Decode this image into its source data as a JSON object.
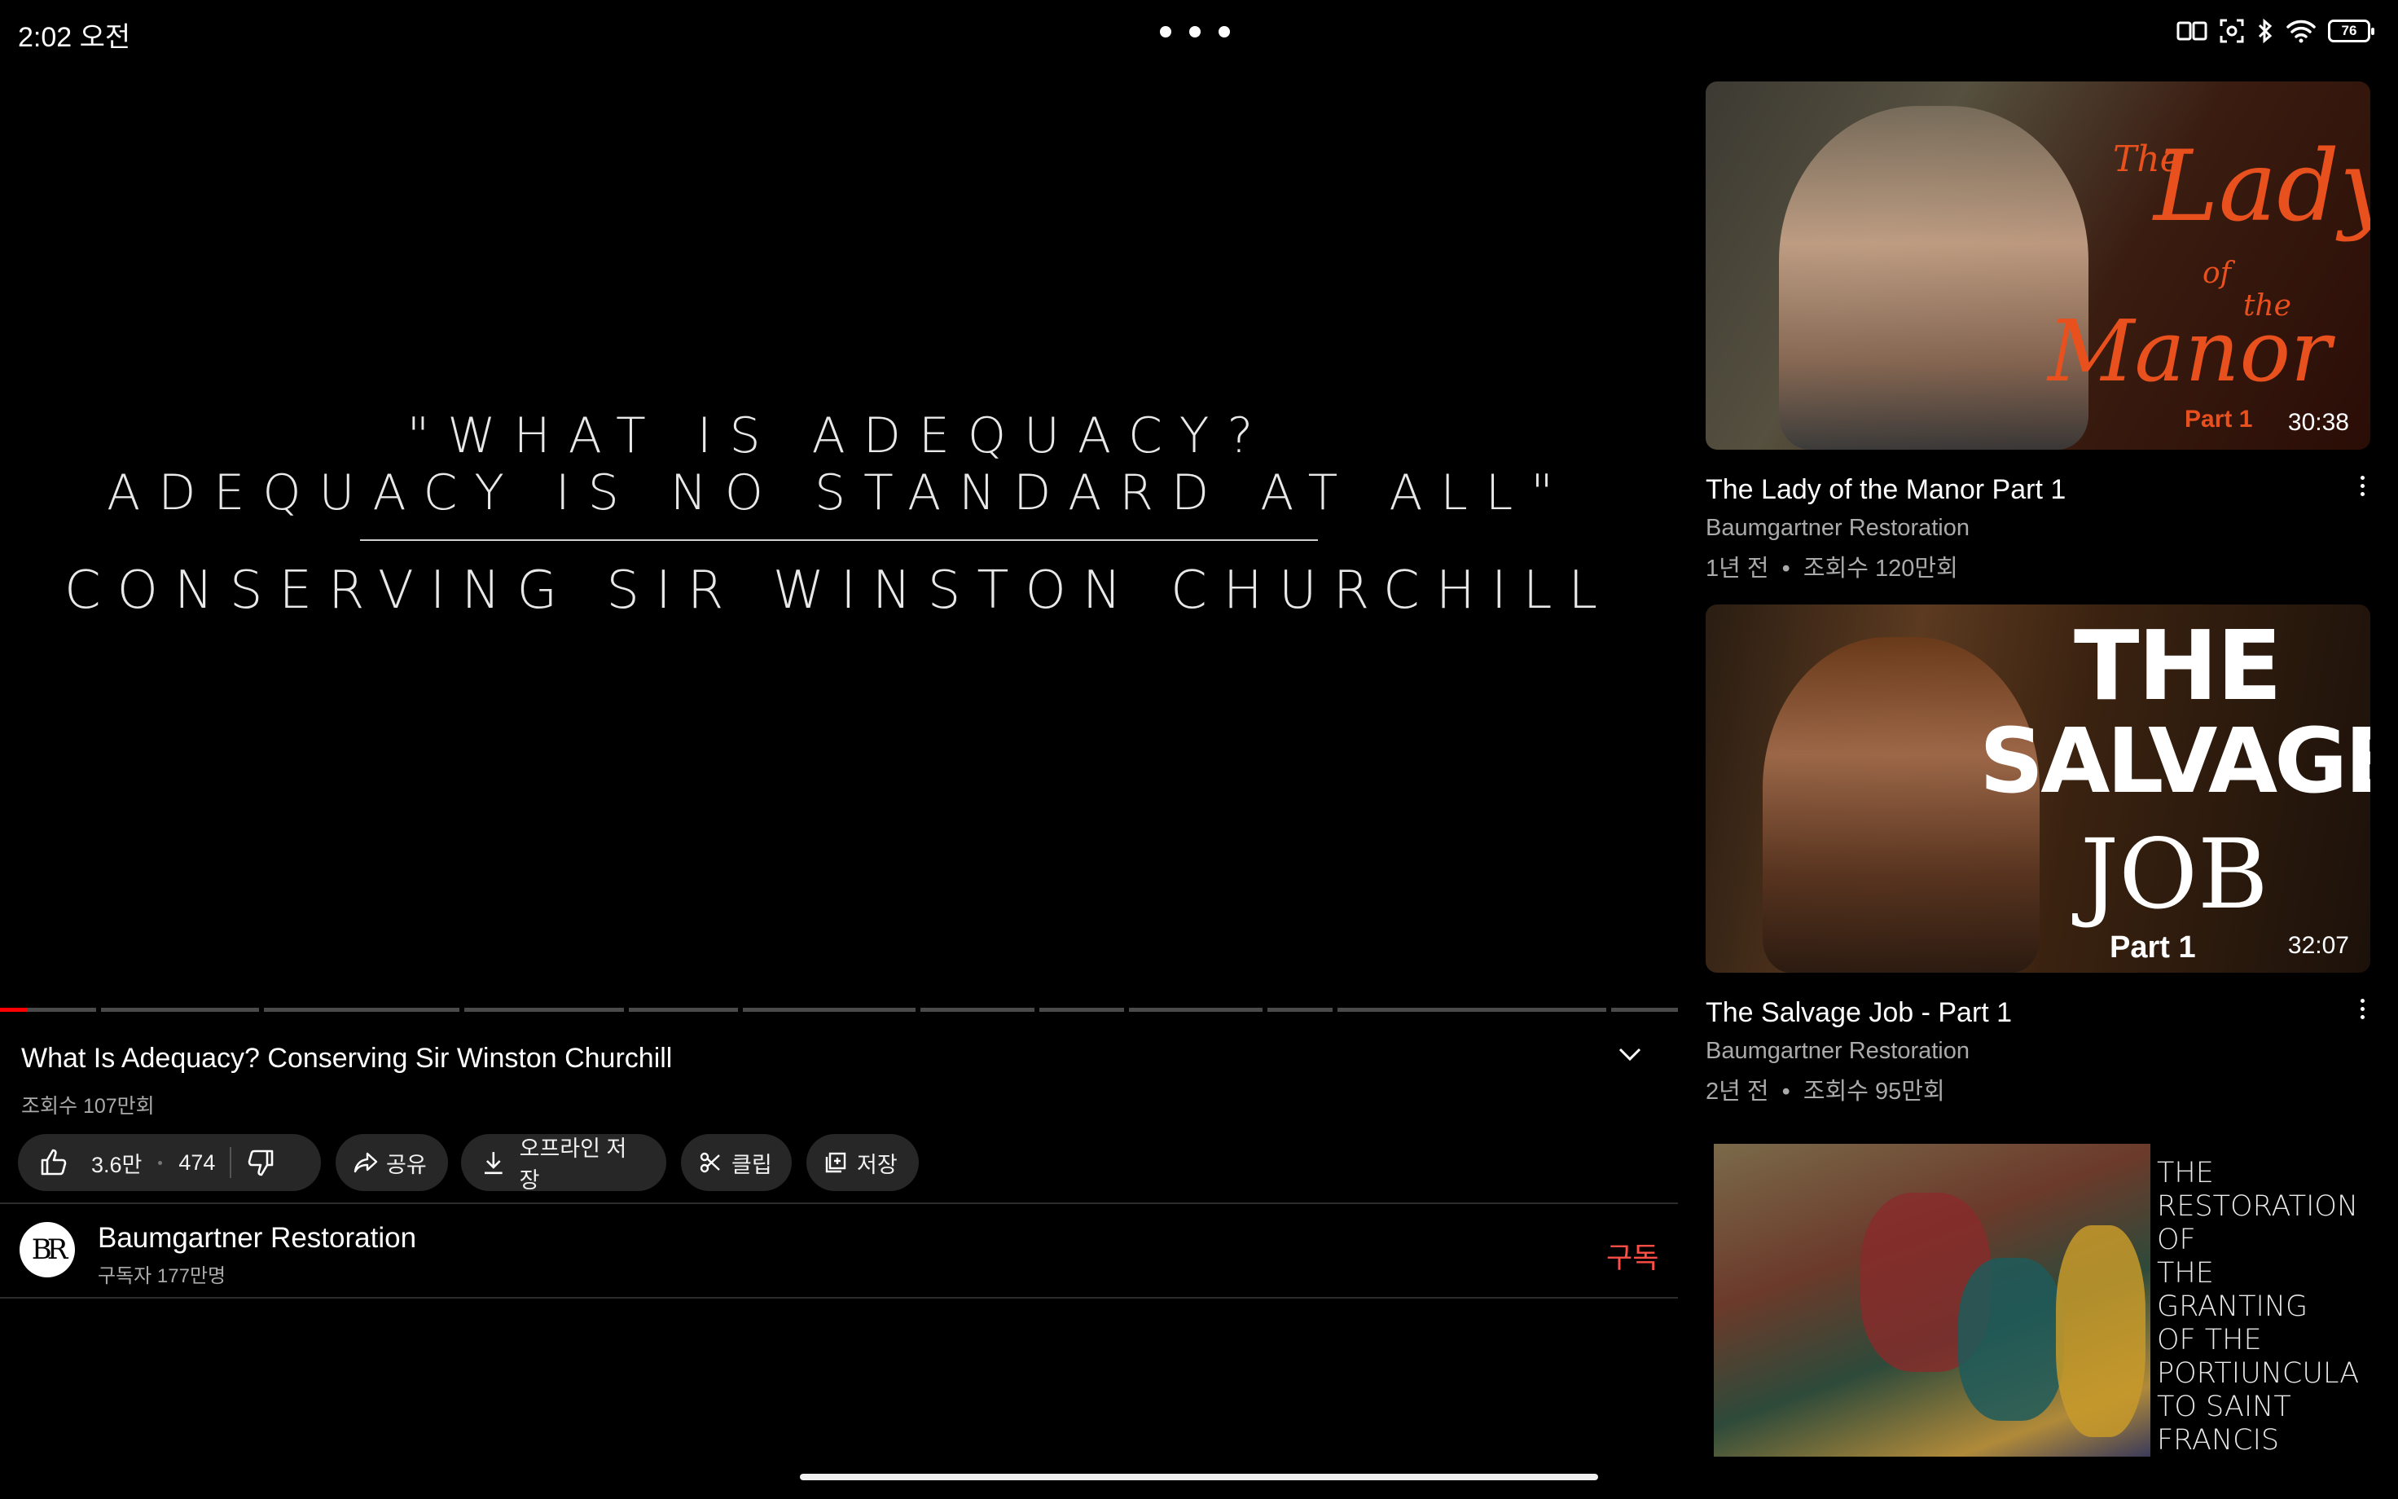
{
  "status_bar": {
    "time": "2:02 오전",
    "battery": "76"
  },
  "player": {
    "quote_line1": "\"WHAT IS ADEQUACY?",
    "quote_line2": "ADEQUACY IS NO STANDARD AT ALL\"",
    "quote_sub": "CONSERVING SIR WINSTON CHURCHILL",
    "progress": 0.016
  },
  "video": {
    "title": "What Is Adequacy? Conserving Sir Winston Churchill",
    "views": "조회수 107만회",
    "likes": "3.6만",
    "dislikes": "474",
    "share_label": "공유",
    "download_label": "오프라인 저장",
    "clip_label": "클립",
    "save_label": "저장"
  },
  "channel": {
    "avatar_text": "BR",
    "name": "Baumgartner Restoration",
    "subscribers": "구독자 177만명",
    "subscribe_label": "구독"
  },
  "recommendations": [
    {
      "thumb_text_main": "Lady",
      "thumb_text_the": "The",
      "thumb_text_of": "of",
      "thumb_text_the2": "the",
      "thumb_text_manor": "Manor",
      "thumb_part": "Part 1",
      "duration": "30:38",
      "title": "The Lady of the Manor Part 1",
      "channel": "Baumgartner Restoration",
      "meta": "1년 전  •  조회수 120만회"
    },
    {
      "thumb_text_the": "THE",
      "thumb_text_salvage": "SALVAGE",
      "thumb_text_job": "JOB",
      "thumb_part": "Part 1",
      "duration": "32:07",
      "title": "The Salvage Job - Part 1",
      "channel": "Baumgartner Restoration",
      "meta": "2년 전  •  조회수 95만회"
    },
    {
      "thumb_lines": [
        "THE",
        "RESTORATION",
        "OF",
        "THE",
        "GRANTING",
        "OF THE",
        "PORTIUNCULA",
        "TO SAINT",
        "FRANCIS"
      ]
    }
  ],
  "colors": {
    "accent": "#ff0000",
    "subscribe": "#ff4e45",
    "manor_orange": "#e8501e"
  }
}
